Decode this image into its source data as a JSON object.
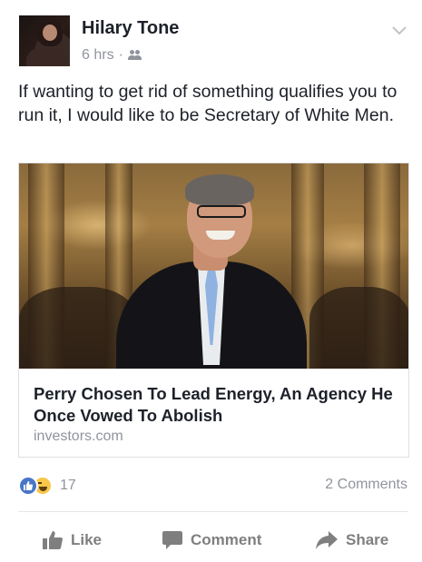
{
  "post": {
    "author": "Hilary Tone",
    "time": "6 hrs",
    "separator": "·",
    "text": "If wanting to get rid of something qualifies you to run it, I would like to be Secretary of White Men."
  },
  "link": {
    "title": "Perry Chosen To Lead Energy, An Agency He Once Vowed To Abolish",
    "domain": "investors.com"
  },
  "reactions": {
    "count": "17",
    "comments": "2 Comments"
  },
  "actions": {
    "like": "Like",
    "comment": "Comment",
    "share": "Share"
  },
  "colors": {
    "name": "#1d2129",
    "meta": "#90949c",
    "like_reaction": "#4a76c9",
    "haha_reaction": "#f7c64a",
    "action_text": "#7f7f7f"
  },
  "icons": [
    "chevron-down-icon",
    "friends-icon",
    "like-reaction-icon",
    "haha-reaction-icon",
    "thumbs-up-icon",
    "comment-icon",
    "share-icon"
  ]
}
